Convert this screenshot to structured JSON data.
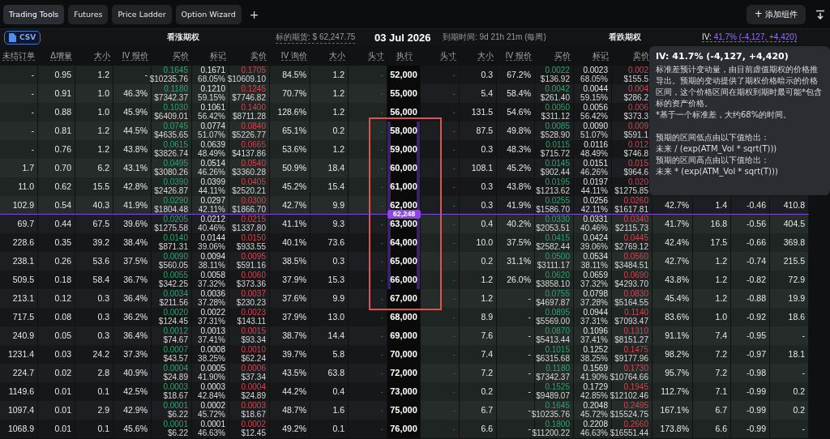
{
  "tabs": [
    {
      "label": "Trading Tools",
      "selected": true
    },
    {
      "label": "Futures",
      "selected": false
    },
    {
      "label": "Price Ladder",
      "selected": false
    },
    {
      "label": "Option Wizard",
      "selected": false
    }
  ],
  "new_tab_label": "+",
  "add_widget": {
    "icon": "+",
    "label": "添加组件"
  },
  "export_button": "CSV",
  "summary": {
    "calls_title": "看涨期权",
    "underlying": "标的期货: $ 62,247.75",
    "expiry_date": "03 Jul 2026",
    "time_to_expiry": "到期时间: 9d 21h 21m (每周)",
    "puts_title": "看跌期权",
    "iv_label": "IV:",
    "iv_value": "41.7% (-4,127, +4,420)"
  },
  "columns": {
    "call": [
      "未结订单",
      "Δ增量",
      "大小",
      "IV 报价",
      "买价",
      "标记",
      "卖价",
      "IV 询价",
      "大小",
      "头寸"
    ],
    "strike": "执行",
    "put": [
      "头寸",
      "大小",
      "IV 报价",
      "买价",
      "标记",
      "卖价"
    ]
  },
  "rows": [
    {
      "kind": "strike",
      "strike": "52,000",
      "in_range": false,
      "call": {
        "open_interest": "-",
        "delta": "0.95",
        "bid_size": "1.2",
        "iv_bid": "-",
        "bid": "0.1645",
        "bid_usd": "$10235.76",
        "mark": "0.1671",
        "mark_iv": "68.05%",
        "ask": "0.1705",
        "ask_usd": "$10609.10",
        "iv_ask": "84.5%",
        "ask_size": "1.2",
        "position": "-"
      },
      "put": {
        "position": "-",
        "bid_size": "0.3",
        "iv_bid": "67.2%",
        "bid": "0.0022",
        "bid_usd": "$136.92",
        "mark": "0.0023",
        "mark_iv": "68.05%",
        "ask": "0.002",
        "ask_usd": "$155.5"
      }
    },
    {
      "kind": "strike",
      "strike": "55,000",
      "in_range": false,
      "call": {
        "open_interest": "-",
        "delta": "0.91",
        "bid_size": "1.0",
        "iv_bid": "46.3%",
        "bid": "0.1180",
        "bid_usd": "$7342.37",
        "mark": "0.1210",
        "mark_iv": "59.15%",
        "ask": "0.1245",
        "ask_usd": "$7746.82",
        "iv_ask": "70.7%",
        "ask_size": "1.2",
        "position": "-"
      },
      "put": {
        "position": "-",
        "bid_size": "5.4",
        "iv_bid": "58.4%",
        "bid": "0.0042",
        "bid_usd": "$261.40",
        "mark": "0.0044",
        "mark_iv": "59.15%",
        "ask": "0.004",
        "ask_usd": "$286.2"
      }
    },
    {
      "kind": "strike",
      "strike": "56,000",
      "in_range": false,
      "call": {
        "open_interest": "-",
        "delta": "0.88",
        "bid_size": "1.0",
        "iv_bid": "45.9%",
        "bid": "0.1030",
        "bid_usd": "$6409.01",
        "mark": "0.1061",
        "mark_iv": "56.42%",
        "ask": "0.1400",
        "ask_usd": "$8711.28",
        "iv_ask": "128.6%",
        "ask_size": "1.2",
        "position": "-"
      },
      "put": {
        "position": "-",
        "bid_size": "131.5",
        "iv_bid": "54.6%",
        "bid": "0.0050",
        "bid_usd": "$311.12",
        "mark": "0.0056",
        "mark_iv": "56.42%",
        "ask": "0.006",
        "ask_usd": "$373.3"
      }
    },
    {
      "kind": "strike",
      "strike": "58,000",
      "in_range": true,
      "call": {
        "open_interest": "-",
        "delta": "0.81",
        "bid_size": "1.2",
        "iv_bid": "44.5%",
        "bid": "0.0745",
        "bid_usd": "$4635.65",
        "mark": "0.0774",
        "mark_iv": "51.07%",
        "ask": "0.0840",
        "ask_usd": "$5226.77",
        "iv_ask": "65.1%",
        "ask_size": "0.2",
        "position": "-"
      },
      "put": {
        "position": "-",
        "bid_size": "87.5",
        "iv_bid": "49.8%",
        "bid": "0.0085",
        "bid_usd": "$528.90",
        "mark": "0.0090",
        "mark_iv": "51.07%",
        "ask": "0.009",
        "ask_usd": "$591.1"
      }
    },
    {
      "kind": "strike",
      "strike": "59,000",
      "in_range": true,
      "call": {
        "open_interest": "-",
        "delta": "0.76",
        "bid_size": "1.2",
        "iv_bid": "43.8%",
        "bid": "0.0615",
        "bid_usd": "$3826.74",
        "mark": "0.0639",
        "mark_iv": "48.49%",
        "ask": "0.0665",
        "ask_usd": "$4137.86",
        "iv_ask": "53.6%",
        "ask_size": "1.2",
        "position": "-"
      },
      "put": {
        "position": "-",
        "bid_size": "0.3",
        "iv_bid": "48.3%",
        "bid": "0.0115",
        "bid_usd": "$715.72",
        "mark": "0.0116",
        "mark_iv": "48.49%",
        "ask": "0.012",
        "ask_usd": "$746.8"
      }
    },
    {
      "kind": "strike",
      "strike": "60,000",
      "in_range": true,
      "call": {
        "open_interest": "1.7",
        "delta": "0.70",
        "bid_size": "6.2",
        "iv_bid": "43.1%",
        "bid": "0.0495",
        "bid_usd": "$3080.26",
        "mark": "0.0514",
        "mark_iv": "46.26%",
        "ask": "0.0540",
        "ask_usd": "$3360.28",
        "iv_ask": "50.9%",
        "ask_size": "18.4",
        "position": "-"
      },
      "put": {
        "position": "-",
        "bid_size": "108.1",
        "iv_bid": "45.2%",
        "bid": "0.0145",
        "bid_usd": "$902.44",
        "mark": "0.0151",
        "mark_iv": "46.26%",
        "ask": "0.015",
        "ask_usd": "$964.6"
      }
    },
    {
      "kind": "strike",
      "strike": "61,000",
      "in_range": true,
      "call": {
        "open_interest": "11.0",
        "delta": "0.62",
        "bid_size": "15.5",
        "iv_bid": "42.8%",
        "bid": "0.0390",
        "bid_usd": "$2426.87",
        "mark": "0.0399",
        "mark_iv": "44.11%",
        "ask": "0.0405",
        "ask_usd": "$2520.21",
        "iv_ask": "45.2%",
        "ask_size": "15.4",
        "position": "-"
      },
      "put": {
        "position": "-",
        "bid_size": "0.3",
        "iv_bid": "43.8%",
        "bid": "0.0195",
        "bid_usd": "$1213.62",
        "mark": "0.0197",
        "mark_iv": "44.11%",
        "ask": "0.020",
        "ask_usd": "$1275.85"
      }
    },
    {
      "kind": "strike",
      "strike": "62,000",
      "in_range": true,
      "call": {
        "open_interest": "102.9",
        "delta": "0.54",
        "bid_size": "40.3",
        "iv_bid": "41.9%",
        "bid": "0.0290",
        "bid_usd": "$1804.48",
        "mark": "0.0297",
        "mark_iv": "42.11%",
        "ask": "0.0300",
        "ask_usd": "$1866.70",
        "iv_ask": "42.7%",
        "ask_size": "9.9",
        "position": "-"
      },
      "put": {
        "position": "-",
        "bid_size": "0.3",
        "iv_bid": "41.9%",
        "bid": "0.0255",
        "bid_usd": "$1586.70",
        "mark": "0.0256",
        "mark_iv": "42.11%",
        "ask": "0.0260",
        "ask_usd": "$1617.81",
        "iv_ask": "42.7%",
        "ask_size": "1.4",
        "delta": "-0.46",
        "open_interest": "410.8"
      }
    },
    {
      "kind": "spot",
      "label": "62,248"
    },
    {
      "kind": "strike",
      "strike": "63,000",
      "in_range": true,
      "call": {
        "open_interest": "69.7",
        "delta": "0.44",
        "bid_size": "67.5",
        "iv_bid": "39.6%",
        "bid": "0.0205",
        "bid_usd": "$1275.58",
        "mark": "0.0212",
        "mark_iv": "40.46%",
        "ask": "0.0215",
        "ask_usd": "$1337.80",
        "iv_ask": "41.1%",
        "ask_size": "9.3",
        "position": "-"
      },
      "put": {
        "position": "-",
        "bid_size": "0.4",
        "iv_bid": "40.2%",
        "bid": "0.0330",
        "bid_usd": "$2053.51",
        "mark": "0.0331",
        "mark_iv": "40.46%",
        "ask": "0.0340",
        "ask_usd": "$2115.73",
        "iv_ask": "41.7%",
        "ask_size": "16.8",
        "delta": "-0.56",
        "open_interest": "404.5"
      }
    },
    {
      "kind": "strike",
      "strike": "64,000",
      "in_range": true,
      "call": {
        "open_interest": "228.6",
        "delta": "0.35",
        "bid_size": "39.2",
        "iv_bid": "38.4%",
        "bid": "0.0140",
        "bid_usd": "$871.31",
        "mark": "0.0144",
        "mark_iv": "39.06%",
        "ask": "0.0150",
        "ask_usd": "$933.55",
        "iv_ask": "40.1%",
        "ask_size": "73.6",
        "position": "-"
      },
      "put": {
        "position": "-",
        "bid_size": "10.0",
        "iv_bid": "37.5%",
        "bid": "0.0415",
        "bid_usd": "$2582.44",
        "mark": "0.0424",
        "mark_iv": "39.06%",
        "ask": "0.0445",
        "ask_usd": "$2769.12",
        "iv_ask": "42.4%",
        "ask_size": "17.5",
        "delta": "-0.66",
        "open_interest": "369.8"
      }
    },
    {
      "kind": "strike",
      "strike": "65,000",
      "in_range": true,
      "call": {
        "open_interest": "238.1",
        "delta": "0.26",
        "bid_size": "53.6",
        "iv_bid": "37.5%",
        "bid": "0.0090",
        "bid_usd": "$560.05",
        "mark": "0.0094",
        "mark_iv": "38.11%",
        "ask": "0.0095",
        "ask_usd": "$591.16",
        "iv_ask": "38.5%",
        "ask_size": "0.3",
        "position": "-"
      },
      "put": {
        "position": "-",
        "bid_size": "0.2",
        "iv_bid": "31.1%",
        "bid": "0.0500",
        "bid_usd": "$3111.17",
        "mark": "0.0534",
        "mark_iv": "38.11%",
        "ask": "0.0560",
        "ask_usd": "$3484.51",
        "iv_ask": "42.7%",
        "ask_size": "1.2",
        "delta": "-0.74",
        "open_interest": "215.5"
      }
    },
    {
      "kind": "strike",
      "strike": "66,000",
      "in_range": true,
      "call": {
        "open_interest": "509.5",
        "delta": "0.18",
        "bid_size": "58.4",
        "iv_bid": "36.7%",
        "bid": "0.0055",
        "bid_usd": "$342.25",
        "mark": "0.0058",
        "mark_iv": "37.32%",
        "ask": "0.0060",
        "ask_usd": "$373.36",
        "iv_ask": "37.9%",
        "ask_size": "15.3",
        "position": "-"
      },
      "put": {
        "position": "-",
        "bid_size": "1.2",
        "iv_bid": "26.0%",
        "bid": "0.0620",
        "bid_usd": "$3858.10",
        "mark": "0.0659",
        "mark_iv": "37.32%",
        "ask": "0.0690",
        "ask_usd": "$4293.70",
        "iv_ask": "43.8%",
        "ask_size": "1.2",
        "delta": "-0.82",
        "open_interest": "72.9"
      }
    },
    {
      "kind": "strike",
      "strike": "67,000",
      "in_range": false,
      "call": {
        "open_interest": "213.1",
        "delta": "0.12",
        "bid_size": "0.3",
        "iv_bid": "36.4%",
        "bid": "0.0034",
        "bid_usd": "$211.56",
        "mark": "0.0036",
        "mark_iv": "37.28%",
        "ask": "0.0037",
        "ask_usd": "$230.23",
        "iv_ask": "37.6%",
        "ask_size": "9.9",
        "position": "-"
      },
      "put": {
        "position": "-",
        "bid_size": "1.2",
        "iv_bid": "-",
        "bid": "0.0755",
        "bid_usd": "$4697.87",
        "mark": "0.0798",
        "mark_iv": "37.28%",
        "ask": "0.0830",
        "ask_usd": "$5164.55",
        "iv_ask": "45.4%",
        "ask_size": "1.2",
        "delta": "-0.88",
        "open_interest": "19.9"
      }
    },
    {
      "kind": "strike",
      "strike": "68,000",
      "in_range": false,
      "call": {
        "open_interest": "717.5",
        "delta": "0.08",
        "bid_size": "0.3",
        "iv_bid": "36.2%",
        "bid": "0.0020",
        "bid_usd": "$124.45",
        "mark": "0.0022",
        "mark_iv": "37.31%",
        "ask": "0.0023",
        "ask_usd": "$143.11",
        "iv_ask": "37.9%",
        "ask_size": "13.0",
        "position": "-"
      },
      "put": {
        "position": "-",
        "bid_size": "8.9",
        "iv_bid": "-",
        "bid": "0.0895",
        "bid_usd": "$5569.00",
        "mark": "0.0944",
        "mark_iv": "37.31%",
        "ask": "0.1140",
        "ask_usd": "$7093.47",
        "iv_ask": "83.6%",
        "ask_size": "1.0",
        "delta": "-0.92",
        "open_interest": "18.6"
      }
    },
    {
      "kind": "strike",
      "strike": "69,000",
      "in_range": false,
      "call": {
        "open_interest": "240.9",
        "delta": "0.05",
        "bid_size": "0.3",
        "iv_bid": "36.4%",
        "bid": "0.0012",
        "bid_usd": "$74.67",
        "mark": "0.0013",
        "mark_iv": "37.41%",
        "ask": "0.0015",
        "ask_usd": "$93.34",
        "iv_ask": "38.7%",
        "ask_size": "14.4",
        "position": "-"
      },
      "put": {
        "position": "-",
        "bid_size": "7.6",
        "iv_bid": "-",
        "bid": "0.0870",
        "bid_usd": "$5413.44",
        "mark": "0.1096",
        "mark_iv": "37.41%",
        "ask": "0.1310",
        "ask_usd": "$8151.27",
        "iv_ask": "91.1%",
        "ask_size": "7.4",
        "delta": "-0.95",
        "open_interest": "-"
      }
    },
    {
      "kind": "strike",
      "strike": "70,000",
      "in_range": false,
      "call": {
        "open_interest": "1231.4",
        "delta": "0.03",
        "bid_size": "24.2",
        "iv_bid": "37.3%",
        "bid": "0.0007",
        "bid_usd": "$43.57",
        "mark": "0.0008",
        "mark_iv": "38.25%",
        "ask": "0.0010",
        "ask_usd": "$62.24",
        "iv_ask": "39.7%",
        "ask_size": "5.8",
        "position": "-"
      },
      "put": {
        "position": "-",
        "bid_size": "7.4",
        "iv_bid": "-",
        "bid": "0.1015",
        "bid_usd": "$6315.68",
        "mark": "0.1252",
        "mark_iv": "38.25%",
        "ask": "0.1475",
        "ask_usd": "$9177.96",
        "iv_ask": "98.2%",
        "ask_size": "7.2",
        "delta": "-0.97",
        "open_interest": "18.1"
      }
    },
    {
      "kind": "strike",
      "strike": "72,000",
      "in_range": false,
      "call": {
        "open_interest": "224.7",
        "delta": "0.02",
        "bid_size": "2.8",
        "iv_bid": "40.9%",
        "bid": "0.0004",
        "bid_usd": "$24.89",
        "mark": "0.0005",
        "mark_iv": "41.90%",
        "ask": "0.0006",
        "ask_usd": "$37.34",
        "iv_ask": "43.5%",
        "ask_size": "63.8",
        "position": "-"
      },
      "put": {
        "position": "-",
        "bid_size": "7.2",
        "iv_bid": "-",
        "bid": "0.1180",
        "bid_usd": "$7342.37",
        "mark": "0.1569",
        "mark_iv": "41.90%",
        "ask": "0.1730",
        "ask_usd": "$10764.66",
        "iv_ask": "95.7%",
        "ask_size": "7.2",
        "delta": "-0.98",
        "open_interest": "-"
      }
    },
    {
      "kind": "strike",
      "strike": "73,000",
      "in_range": false,
      "call": {
        "open_interest": "1149.6",
        "delta": "0.01",
        "bid_size": "0.1",
        "iv_bid": "42.5%",
        "bid": "0.0003",
        "bid_usd": "$18.67",
        "mark": "0.0003",
        "mark_iv": "42.84%",
        "ask": "0.0004",
        "ask_usd": "$24.89",
        "iv_ask": "44.2%",
        "ask_size": "0.4",
        "position": "-"
      },
      "put": {
        "position": "-",
        "bid_size": "0.2",
        "iv_bid": "-",
        "bid": "0.1525",
        "bid_usd": "$9489.07",
        "mark": "0.1729",
        "mark_iv": "42.85%",
        "ask": "0.1945",
        "ask_usd": "$12102.46",
        "iv_ask": "112.7%",
        "ask_size": "7.1",
        "delta": "-0.99",
        "open_interest": "0.2"
      }
    },
    {
      "kind": "strike",
      "strike": "75,000",
      "in_range": false,
      "call": {
        "open_interest": "1097.4",
        "delta": "0.01",
        "bid_size": "2.9",
        "iv_bid": "42.9%",
        "bid": "0.0001",
        "bid_usd": "$6.22",
        "mark": "0.0002",
        "mark_iv": "45.72%",
        "ask": "0.0003",
        "ask_usd": "$18.67",
        "iv_ask": "48.7%",
        "ask_size": "1.6",
        "position": "-"
      },
      "put": {
        "position": "-",
        "bid_size": "6.7",
        "iv_bid": "-",
        "bid": "0.1645",
        "bid_usd": "$10235.76",
        "mark": "0.2048",
        "mark_iv": "45.72%",
        "ask": "0.2495",
        "ask_usd": "$15524.75",
        "iv_ask": "167.1%",
        "ask_size": "6.7",
        "delta": "-0.99",
        "open_interest": "0.2"
      }
    },
    {
      "kind": "strike",
      "strike": "76,000",
      "in_range": false,
      "call": {
        "open_interest": "1068.9",
        "delta": "0.01",
        "bid_size": "0.1",
        "iv_bid": "45.6%",
        "bid": "0.0001",
        "bid_usd": "$6.22",
        "mark": "0.0001",
        "mark_iv": "46.63%",
        "ask": "0.0002",
        "ask_usd": "$12.45",
        "iv_ask": "49.2%",
        "ask_size": "0.1",
        "position": "-"
      },
      "put": {
        "position": "-",
        "bid_size": "6.6",
        "iv_bid": "-",
        "bid": "0.1800",
        "bid_usd": "$11200.22",
        "mark": "0.2208",
        "mark_iv": "46.63%",
        "ask": "0.2660",
        "ask_usd": "$16551.44",
        "iv_ask": "173.8%",
        "ask_size": "6.6",
        "delta": "-0.99",
        "open_interest": "-"
      }
    }
  ],
  "tooltip": {
    "title": "IV: 41.7% (-4,127, +4,420)",
    "lines": [
      "标准差预计变动量，由目前虚值期权的价格推导出。预期的变动提供了期权价格暗示的价格区间，这个价格区间在期权到期时最可能*包含标的资产价格。",
      "*基于一个标准差，大约68%的时间。",
      "预期的区间低点由以下值给出：",
      "未来 / (exp(ATM_Vol * sqrt(T)))",
      "预期的区间高点由以下值给出：",
      "未来 * (exp(ATM_Vol * sqrt(T)))"
    ]
  }
}
